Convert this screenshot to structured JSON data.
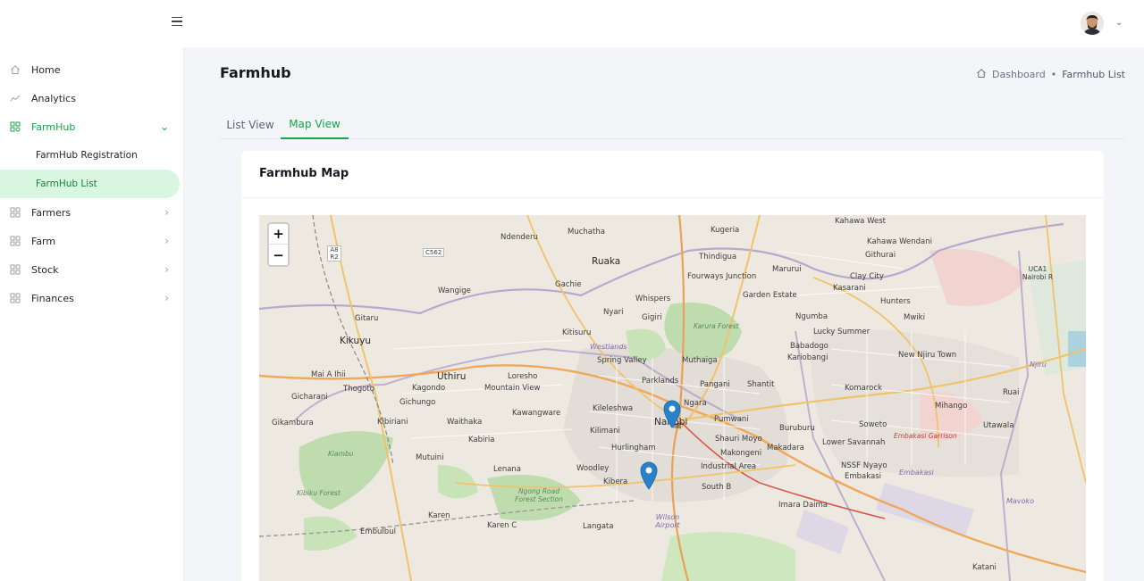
{
  "header": {
    "menu_icon": "hamburger-icon",
    "user_menu_icon": "chevron-down-icon"
  },
  "sidebar": {
    "items": [
      {
        "label": "Home",
        "icon": "home-icon"
      },
      {
        "label": "Analytics",
        "icon": "trend-line-icon"
      },
      {
        "label": "FarmHub",
        "icon": "grid-icon",
        "expanded": true,
        "children": [
          {
            "label": "FarmHub Registration"
          },
          {
            "label": "FarmHub List",
            "selected": true
          }
        ]
      },
      {
        "label": "Farmers",
        "icon": "grid-icon"
      },
      {
        "label": "Farm",
        "icon": "grid-icon"
      },
      {
        "label": "Stock",
        "icon": "grid-icon"
      },
      {
        "label": "Finances",
        "icon": "grid-icon"
      }
    ]
  },
  "page": {
    "title": "Farmhub",
    "breadcrumb": {
      "home": "Dashboard",
      "separator": "•",
      "current": "Farmhub List"
    }
  },
  "tabs": [
    {
      "label": "List View"
    },
    {
      "label": "Map View",
      "active": true
    }
  ],
  "card": {
    "title": "Farmhub Map"
  },
  "map": {
    "zoom_in": "+",
    "zoom_out": "−",
    "labels": {
      "ndenderu": "Ndenderu",
      "muchatha": "Muchatha",
      "kugeria": "Kugeria",
      "kahawa_west": "Kahawa West",
      "kahawa_wendani": "Kahawa Wendani",
      "githurai": "Githurai",
      "ruaka": "Ruaka",
      "thindigua": "Thindigua",
      "marurui": "Marurui",
      "clay_city": "Clay City",
      "kasarani": "Kasarani",
      "wangige": "Wangige",
      "gachie": "Gachie",
      "whispers": "Whispers",
      "fourways": "Fourways Junction",
      "garden_estate": "Garden Estate",
      "hunters": "Hunters",
      "mwiki": "Mwiki",
      "nyari": "Nyari",
      "gigiri": "Gigiri",
      "ngumba": "Ngumba",
      "gitaru": "Gitaru",
      "kikuyu": "Kikuyu",
      "kitisuru": "Kitisuru",
      "karura_forest": "Karura Forest",
      "lucky_summer": "Lucky Summer",
      "westlands": "Westlands",
      "babadogo": "Babadogo",
      "ma_a_ithi": "Mai A Ihii",
      "uthiru": "Uthiru",
      "spring_valley": "Spring Valley",
      "muthaiga": "Muthaiga",
      "kariobangi": "Kariobangi",
      "new_njiru": "New Njiru Town",
      "thogoto": "Thogoto",
      "kagondo": "Kagondo",
      "loresho": "Loresho",
      "mountain_view": "Mountain View",
      "parklands": "Parklands",
      "pangani": "Pangani",
      "shantit": "Shantit",
      "komarock": "Komarock",
      "ruai": "Ruai",
      "gicharani": "Gicharani",
      "gichungo": "Gichungo",
      "ngara": "Ngara",
      "mihango": "Mihango",
      "kawangware": "Kawangware",
      "kileleshwa": "Kileleshwa",
      "pumwani": "Pumwani",
      "soweto": "Soweto",
      "gikambura": "Gikambura",
      "kibiriani": "Kibiriani",
      "waithaka": "Waithaka",
      "nairobi": "Nairobi",
      "buruburu": "Buruburu",
      "utawala": "Utawala",
      "kilimani": "Kilimani",
      "kabiria": "Kabiria",
      "shauri_moyo": "Shauri Moyo",
      "makadara": "Makadara",
      "lower_savannah": "Lower Savannah",
      "embakasi_garrison": "Embakasi Garrison",
      "hurlingham": "Hurlingham",
      "mutuini": "Mutuini",
      "makongeni": "Makongeni",
      "kiambu": "Kiambu",
      "lenana": "Lenana",
      "woodley": "Woodley",
      "industrial_area": "Industrial Area",
      "nssf_nyayo": "NSSF Nyayo",
      "embakasi": "Embakasi",
      "kibera": "Kibera",
      "south_b": "South B",
      "kibiku_forest": "Kibiku Forest",
      "ngong_forest": "Ngong Road Forest Section",
      "imara_daima": "Imara Daima",
      "mavoko": "Mavoko",
      "karen": "Karen",
      "wilson_airport": "Wilson Airport",
      "langata": "Langata",
      "karen_c": "Karen C",
      "embulbul": "Embulbul",
      "katani": "Katani",
      "njiru": "Njiru",
      "uca1": "UCA1 Nairobi R",
      "a8r2": "A8 R2",
      "c562": "C562"
    },
    "markers": [
      {
        "label": "farmhub-marker-1"
      },
      {
        "label": "farmhub-marker-2"
      }
    ]
  },
  "colors": {
    "accent": "#16a34a",
    "accent_light": "#d8f6e0",
    "marker": "#2a81cb"
  }
}
